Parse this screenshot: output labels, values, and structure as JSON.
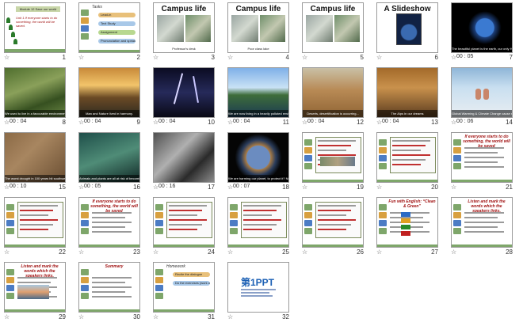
{
  "slides": [
    {
      "number": "1",
      "duration": "",
      "title": "",
      "caption": "",
      "subtitle": "Module 12 Save our world",
      "body": "Unit 1 If everyone starts to do something, the world will be saved."
    },
    {
      "number": "2",
      "duration": "",
      "title": "Tasks",
      "caption": "",
      "pills": [
        "Lead-in",
        "Text Study",
        "Assignment",
        "Pronunciation and speaking"
      ]
    },
    {
      "number": "3",
      "duration": "",
      "title": "Campus life",
      "caption": "Professor's  desk"
    },
    {
      "number": "4",
      "duration": "",
      "title": "Campus life",
      "caption": "Poor class lake"
    },
    {
      "number": "5",
      "duration": "",
      "title": "Campus life",
      "caption": ""
    },
    {
      "number": "6",
      "duration": "",
      "title": "A Slideshow",
      "caption": ""
    },
    {
      "number": "7",
      "duration": "00 : 05",
      "title": "",
      "caption": "The beautiful planet is the earth, our only HOME."
    },
    {
      "number": "8",
      "duration": "00 : 04",
      "title": "",
      "caption": "We used to live in a favourable environment."
    },
    {
      "number": "9",
      "duration": "00 : 04",
      "title": "",
      "caption": "Man and Nature lived in harmony."
    },
    {
      "number": "10",
      "duration": "00 : 04",
      "title": "",
      "caption": ""
    },
    {
      "number": "11",
      "duration": "00 : 04",
      "title": "",
      "caption": "We are now living in a heavily polluted environment."
    },
    {
      "number": "12",
      "duration": "00 : 04",
      "title": "",
      "caption": "Deserts, desertification is occurring..."
    },
    {
      "number": "13",
      "duration": "00 : 04",
      "title": "",
      "caption": "The Alps in our dreams"
    },
    {
      "number": "14",
      "duration": "00 : 06",
      "title": "",
      "caption": "Global Warming & Climate Change cause major issues."
    },
    {
      "number": "15",
      "duration": "00 : 10",
      "title": "",
      "caption": "The worst drought in 100 years hit southwest China."
    },
    {
      "number": "16",
      "duration": "00 : 05",
      "title": "",
      "caption": "Animals and plants are all at risk of becoming extinct."
    },
    {
      "number": "17",
      "duration": "00 : 16",
      "title": "",
      "caption": ""
    },
    {
      "number": "18",
      "duration": "00 : 07",
      "title": "",
      "caption": "We are harming our planet, to protect it? Now!"
    },
    {
      "number": "19",
      "duration": "",
      "title": "",
      "caption": ""
    },
    {
      "number": "20",
      "duration": "",
      "title": "",
      "caption": ""
    },
    {
      "number": "21",
      "duration": "",
      "title": "If everyone starts to do something, the world will be saved",
      "caption": ""
    },
    {
      "number": "22",
      "duration": "",
      "title": "",
      "caption": ""
    },
    {
      "number": "23",
      "duration": "",
      "title": "If everyone starts to do something, the world will be saved",
      "caption": ""
    },
    {
      "number": "24",
      "duration": "",
      "title": "",
      "caption": ""
    },
    {
      "number": "25",
      "duration": "",
      "title": "",
      "caption": ""
    },
    {
      "number": "26",
      "duration": "",
      "title": "",
      "caption": ""
    },
    {
      "number": "27",
      "duration": "",
      "title": "Fun with English: “Clean & Green”",
      "caption": ""
    },
    {
      "number": "28",
      "duration": "",
      "title": "Listen and mark the words which the speakers links.",
      "caption": ""
    },
    {
      "number": "29",
      "duration": "",
      "title": "Listen and mark the words which the speakers links.",
      "caption": ""
    },
    {
      "number": "30",
      "duration": "",
      "title": "Summary",
      "caption": ""
    },
    {
      "number": "31",
      "duration": "",
      "title": "Homework",
      "caption": "",
      "pills": [
        "Recite the dialogue",
        "Do the exercises  (work on page 75)"
      ]
    },
    {
      "number": "32",
      "duration": "",
      "title": "第1PPT",
      "caption": ""
    }
  ],
  "colors": {
    "accent": "#3a6fc4",
    "theme_green": "#7ea66a",
    "title_red": "#a01010"
  }
}
